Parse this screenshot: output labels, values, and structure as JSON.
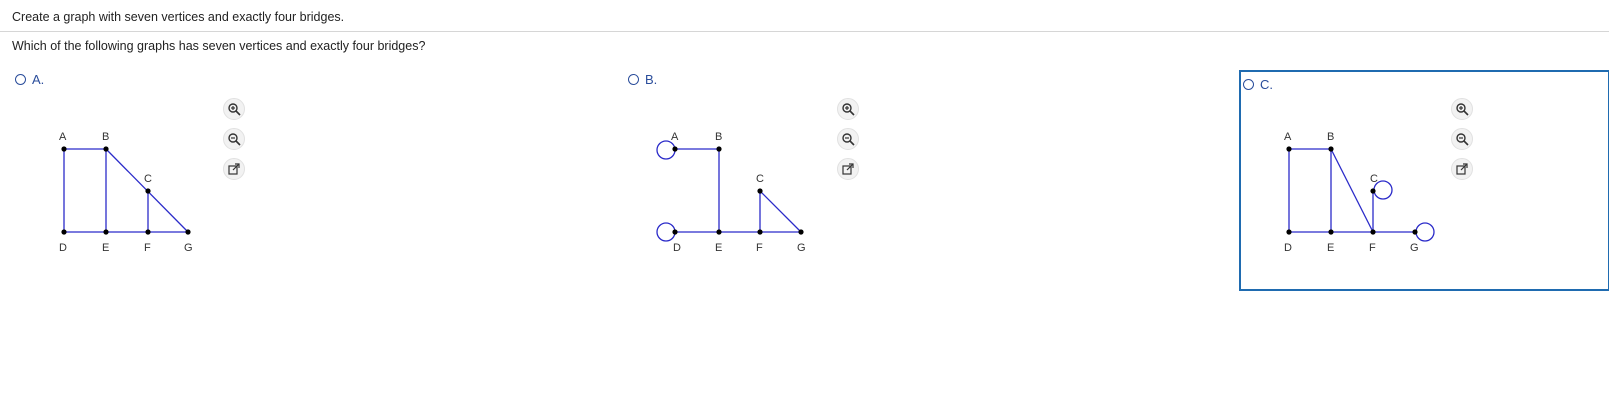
{
  "question": {
    "title": "Create a graph with seven vertices and exactly four bridges.",
    "prompt": "Which of the following graphs has seven vertices and exactly four bridges?"
  },
  "options": [
    {
      "label": "A.",
      "selected": false
    },
    {
      "label": "B.",
      "selected": false
    },
    {
      "label": "C.",
      "selected": true
    }
  ],
  "vertex_labels": [
    "A",
    "B",
    "C",
    "D",
    "E",
    "F",
    "G"
  ],
  "tools": {
    "zoom_in": "zoom-in-icon",
    "zoom_out": "zoom-out-icon",
    "open": "open-new-window-icon"
  },
  "colors": {
    "edge": "#2b2bc9",
    "selected_border": "#1f6bb0",
    "option_label": "#2a4d9b"
  }
}
